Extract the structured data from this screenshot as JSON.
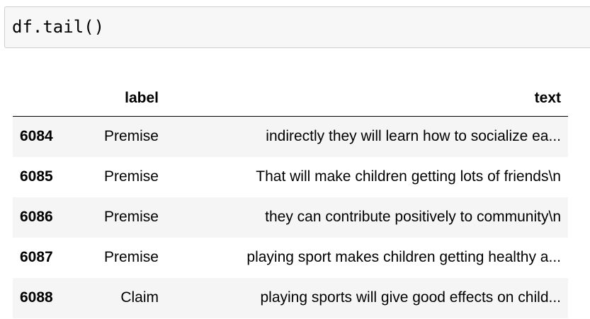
{
  "code_cell": {
    "source": "df.tail()"
  },
  "output_table": {
    "columns": [
      "",
      "label",
      "text"
    ],
    "rows": [
      {
        "index": "6084",
        "label": "Premise",
        "text": "indirectly they will learn how to socialize ea..."
      },
      {
        "index": "6085",
        "label": "Premise",
        "text": "That will make children getting lots of friends\\n"
      },
      {
        "index": "6086",
        "label": "Premise",
        "text": "they can contribute positively to community\\n"
      },
      {
        "index": "6087",
        "label": "Premise",
        "text": "playing sport makes children getting healthy a..."
      },
      {
        "index": "6088",
        "label": "Claim",
        "text": "playing sports will give good effects on child..."
      }
    ]
  },
  "colors": {
    "code_background": "#f7f7f7",
    "code_border": "#cfcfcf",
    "striped_row": "#f5f5f5"
  }
}
